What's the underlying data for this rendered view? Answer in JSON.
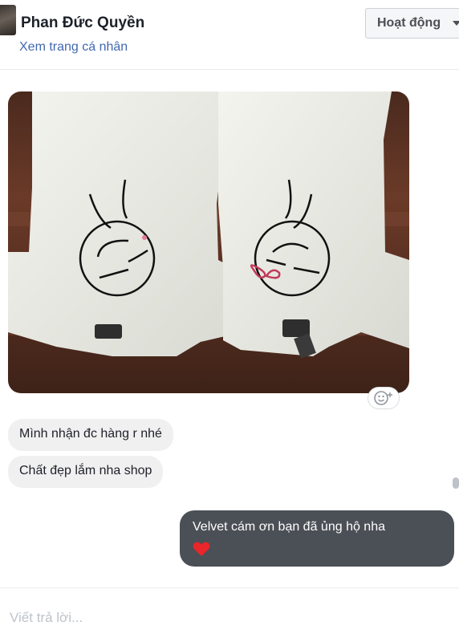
{
  "header": {
    "name": "Phan Đức Quyền",
    "profile_link": "Xem trang cá nhân",
    "status_button": "Hoạt động"
  },
  "messages": [
    {
      "direction": "incoming",
      "text": "Mình nhận đc hàng r nhé"
    },
    {
      "direction": "incoming",
      "text": "Chất đẹp lắm nha shop"
    },
    {
      "direction": "outgoing",
      "text": "Velvet cám ơn bạn đã ủng hộ nha",
      "emoji": "heart-icon"
    }
  ],
  "reply": {
    "placeholder": "Viết trả lời..."
  },
  "colors": {
    "link": "#4267b2",
    "incoming_bubble": "#f1f0f0",
    "outgoing_bubble": "#4b4f56",
    "heart": "#e8262b"
  }
}
